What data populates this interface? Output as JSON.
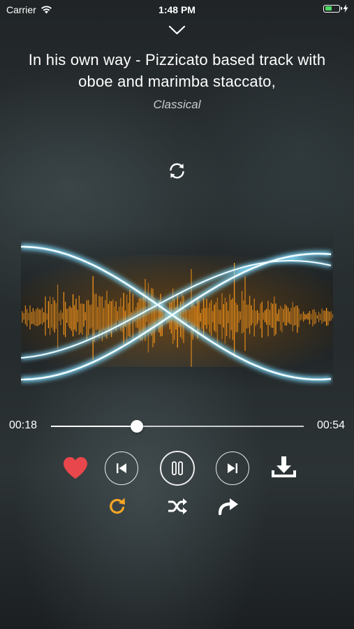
{
  "status_bar": {
    "carrier": "Carrier",
    "time": "1:48 PM",
    "battery_color": "#4cd964"
  },
  "player": {
    "title": "In his own way - Pizzicato based track with oboe and marimba staccato,",
    "genre": "Classical",
    "elapsed": "00:18",
    "total": "00:54",
    "progress_fraction": 0.34
  },
  "icons": {
    "collapse": "chevron-down-icon",
    "repeat_top": "refresh-icon",
    "favorite": "heart-icon",
    "previous": "skip-previous-icon",
    "pause": "pause-icon",
    "next": "skip-next-icon",
    "download": "download-icon",
    "repeat": "repeat-icon",
    "shuffle": "shuffle-icon",
    "share": "share-icon"
  },
  "colors": {
    "heart": "#e8474b",
    "repeat_active": "#f5a623",
    "waveform": "#ff9a1a",
    "glow_lines": "#d8f6ff"
  }
}
